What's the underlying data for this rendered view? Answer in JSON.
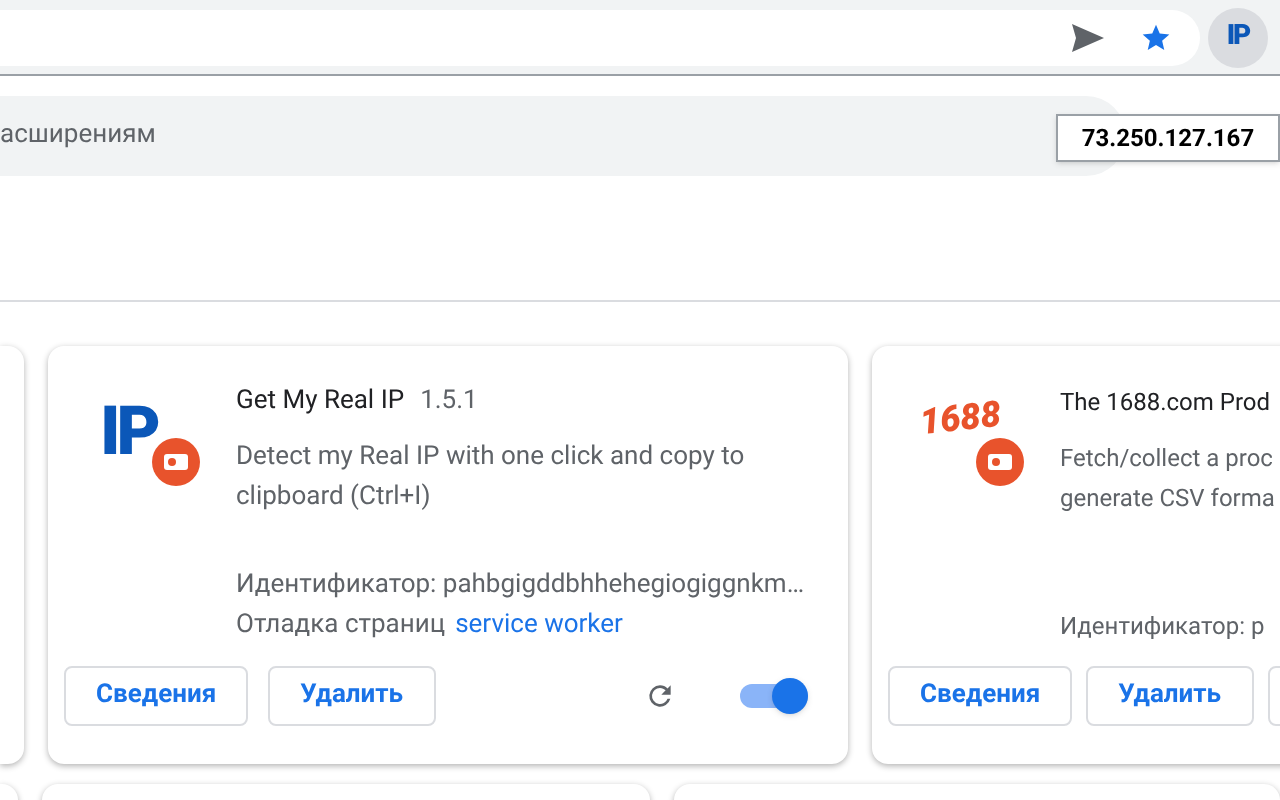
{
  "toolbar": {
    "extension_badge": "IP",
    "tooltip": "73.250.127.167"
  },
  "search": {
    "value": "асширениям"
  },
  "cards": [
    {
      "logo": "IP",
      "kind": "monogram",
      "title": "Get My Real IP",
      "version": "1.5.1",
      "description": "Detect my Real IP with one click and copy to clipboard (Ctrl+I)",
      "id_line": "Идентификатор: pahbgigddbhhehegiogiggnkm…",
      "inspect_label": "Отладка страниц",
      "inspect_link": "service worker",
      "buttons": [
        "Сведения",
        "Удалить"
      ],
      "enabled": true
    },
    {
      "logo": "1688",
      "kind": "wordmark",
      "title": "The 1688.com Prod",
      "description_lines": [
        "Fetch/collect a proc",
        "generate CSV forma"
      ],
      "id_line": "Идентификатор: p",
      "buttons": [
        "Сведения",
        "Удалить"
      ]
    }
  ]
}
